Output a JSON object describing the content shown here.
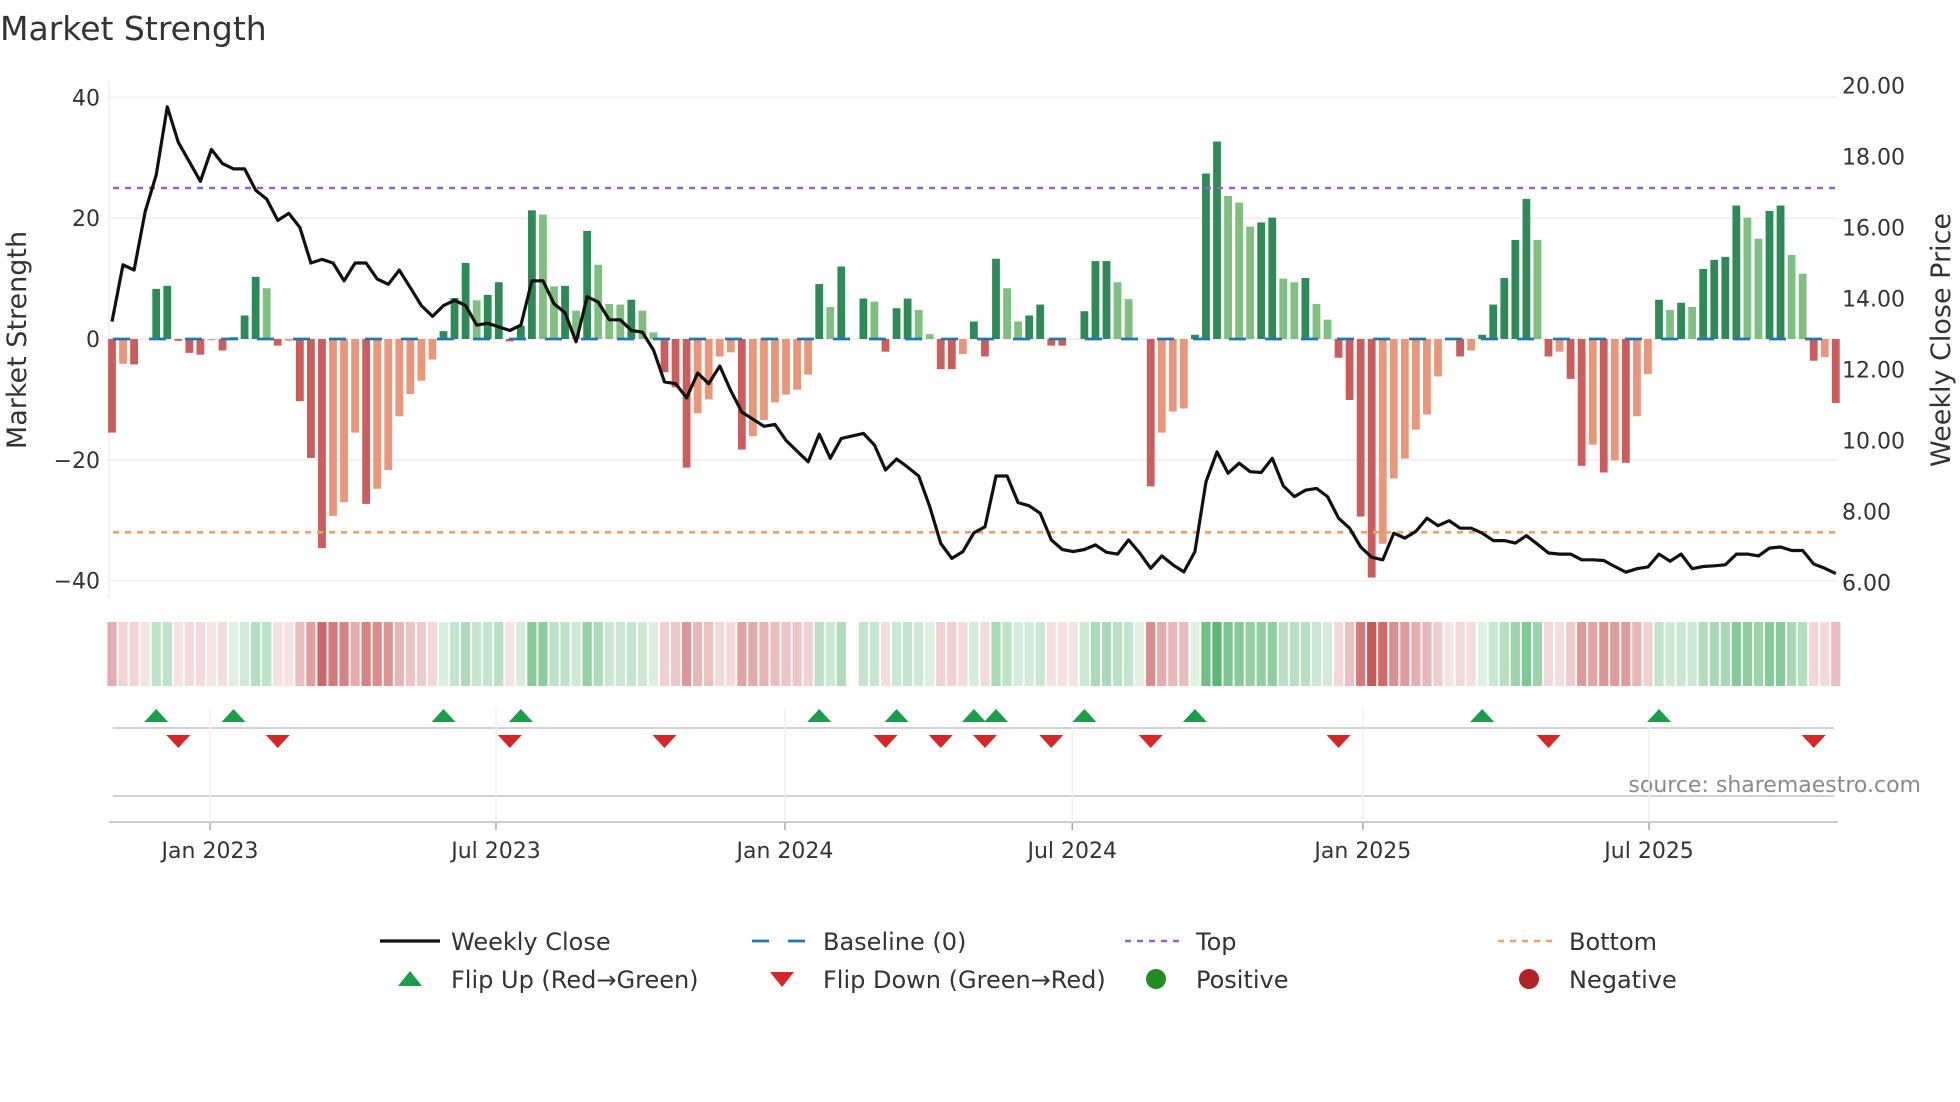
{
  "chart_data": {
    "type": "bar",
    "title": "Market Strength",
    "ylabel": "Market Strength",
    "y2label": "Weekly Close Price",
    "ylim": [
      -42,
      42
    ],
    "y2lim": [
      5.73,
      20.35
    ],
    "yticks": [
      "40",
      "20",
      "0",
      "−20",
      "−40"
    ],
    "ytick_values": [
      40,
      20,
      0,
      -20,
      -40
    ],
    "y2ticks": [
      "20.00",
      "18.00",
      "16.00",
      "14.00",
      "12.00",
      "10.00",
      "8.00",
      "6.00"
    ],
    "y2tick_values": [
      20,
      18,
      16,
      14,
      12,
      10,
      8,
      6
    ],
    "x_unit": "week index",
    "x_ticks": [
      {
        "label": "Jan 2023",
        "at": 8.87
      },
      {
        "label": "Jul 2023",
        "at": 34.75
      },
      {
        "label": "Jan 2024",
        "at": 60.9
      },
      {
        "label": "Jul 2024",
        "at": 86.9
      },
      {
        "label": "Jan 2025",
        "at": 113.2
      },
      {
        "label": "Jul 2025",
        "at": 139.1
      }
    ],
    "top_level": 25,
    "bottom_level": -32,
    "baseline": 0,
    "strength": [
      -15.5,
      -4.1,
      -4.2,
      0,
      8.3,
      8.8,
      -0.3,
      -2.3,
      -2.6,
      -0.2,
      -1.9,
      0.3,
      3.9,
      10.3,
      8.4,
      -1.1,
      -0.3,
      -10.3,
      -19.7,
      -34.6,
      -29.3,
      -27,
      -15.5,
      -27.3,
      -24.8,
      -21.7,
      -12.8,
      -9.1,
      -6.9,
      -3.4,
      1.3,
      6.8,
      12.6,
      6.4,
      7.3,
      9.4,
      -0.4,
      2.2,
      21.3,
      20.6,
      8.7,
      8.8,
      4.7,
      17.9,
      12.3,
      5.8,
      5.7,
      6.5,
      4.7,
      1.1,
      -5.5,
      -8.0,
      -21.3,
      -12.3,
      -10,
      -2.9,
      -2.2,
      -18.3,
      -16.1,
      -13.4,
      -10.5,
      -9.2,
      -8.4,
      -5.9,
      9.1,
      5.3,
      12.0,
      0,
      6.7,
      6.2,
      -2.1,
      5.1,
      6.7,
      4.8,
      0.8,
      -5.0,
      -5.0,
      -2.5,
      2.9,
      -2.9,
      13.3,
      8.4,
      2.9,
      3.9,
      5.7,
      -1.1,
      -1.1,
      0,
      4.6,
      12.9,
      12.9,
      9.4,
      6.6,
      0,
      -24.4,
      -15.5,
      -12.0,
      -11.5,
      0.7,
      27.4,
      32.7,
      23.7,
      22.6,
      18.6,
      19.3,
      20.1,
      10.0,
      9.4,
      10.1,
      5.8,
      3.2,
      -3.1,
      -10.1,
      -29.4,
      -39.5,
      -33.9,
      -23.1,
      -19.8,
      -15.0,
      -12.5,
      -6.2,
      0,
      -2.9,
      -1.9,
      0.7,
      5.7,
      10.1,
      16.4,
      23.2,
      16.4,
      -2.9,
      -2.1,
      -6.6,
      -21.0,
      -17.5,
      -22.1,
      -20.1,
      -20.5,
      -12.8,
      -5.8,
      6.5,
      4.8,
      6.0,
      5.3,
      11.6,
      13.1,
      13.6,
      22.1,
      20.1,
      16.6,
      21.2,
      22.1,
      13.9,
      10.8,
      -3.6,
      -3.0,
      -10.6
    ],
    "weekly_close": [
      13.35,
      14.95,
      14.8,
      16.45,
      17.48,
      19.4,
      18.4,
      17.85,
      17.3,
      18.2,
      17.8,
      17.65,
      17.65,
      17.05,
      16.8,
      16.2,
      16.4,
      16.0,
      15.0,
      15.1,
      15.0,
      14.5,
      15.0,
      15.0,
      14.55,
      14.4,
      14.8,
      14.3,
      13.8,
      13.5,
      13.8,
      13.95,
      13.8,
      13.25,
      13.3,
      13.2,
      13.1,
      13.25,
      14.5,
      14.5,
      13.85,
      13.6,
      12.78,
      14.05,
      13.9,
      13.4,
      13.4,
      13.1,
      13.05,
      12.55,
      11.65,
      11.6,
      11.2,
      11.9,
      11.6,
      12.1,
      11.4,
      10.8,
      10.6,
      10.4,
      10.45,
      10.0,
      9.7,
      9.4,
      10.18,
      9.5,
      10.06,
      10.13,
      10.2,
      9.87,
      9.17,
      9.48,
      9.25,
      9.0,
      8.14,
      7.1,
      6.68,
      6.87,
      7.4,
      7.57,
      9.0,
      9.0,
      8.25,
      8.16,
      7.95,
      7.2,
      6.93,
      6.87,
      6.93,
      7.06,
      6.85,
      6.8,
      7.2,
      6.83,
      6.4,
      6.75,
      6.5,
      6.3,
      6.87,
      8.84,
      9.68,
      9.08,
      9.36,
      9.12,
      9.1,
      9.5,
      8.72,
      8.42,
      8.6,
      8.65,
      8.42,
      7.81,
      7.53,
      7.0,
      6.71,
      6.64,
      7.39,
      7.25,
      7.44,
      7.81,
      7.6,
      7.74,
      7.53,
      7.53,
      7.39,
      7.18,
      7.18,
      7.11,
      7.32,
      7.08,
      6.83,
      6.8,
      6.8,
      6.64,
      6.64,
      6.62,
      6.45,
      6.29,
      6.39,
      6.44,
      6.8,
      6.6,
      6.8,
      6.39,
      6.45,
      6.47,
      6.5,
      6.8,
      6.8,
      6.75,
      6.97,
      7.0,
      6.9,
      6.9,
      6.52,
      6.4,
      6.25
    ],
    "strip_blank": [
      67
    ],
    "flip_up": [
      4,
      11,
      30,
      37,
      64,
      71,
      78,
      80,
      88,
      98,
      124,
      140
    ],
    "flip_down": [
      6,
      15,
      36,
      50,
      70,
      75,
      79,
      85,
      94,
      111,
      130,
      154
    ],
    "grid": true,
    "legend_position": "bottom",
    "legend": [
      {
        "label": "Weekly Close",
        "kind": "line"
      },
      {
        "label": "Baseline (0)",
        "kind": "dash"
      },
      {
        "label": "Top",
        "kind": "dot"
      },
      {
        "label": "Bottom",
        "kind": "dot-bottom"
      },
      {
        "label": "Flip Up (Red→Green)",
        "kind": "up"
      },
      {
        "label": "Flip Down (Green→Red)",
        "kind": "down"
      },
      {
        "label": "Positive",
        "kind": "pos"
      },
      {
        "label": "Negative",
        "kind": "neg"
      }
    ],
    "source": "source: sharemaestro.com"
  },
  "colors": {
    "bar_up_strong": "#2e8b57",
    "bar_up_weak": "#7fbf7f",
    "bar_down_strong": "#cd5c5c",
    "bar_down_weak": "#e9967a",
    "close_line": "#111111",
    "baseline": "#1f77b4",
    "top": "#9b5fd6",
    "bottom": "#f0a060",
    "flip_up": "#1a9e4a",
    "flip_down": "#d62728",
    "positive": "#228b22",
    "negative": "#b22222"
  }
}
